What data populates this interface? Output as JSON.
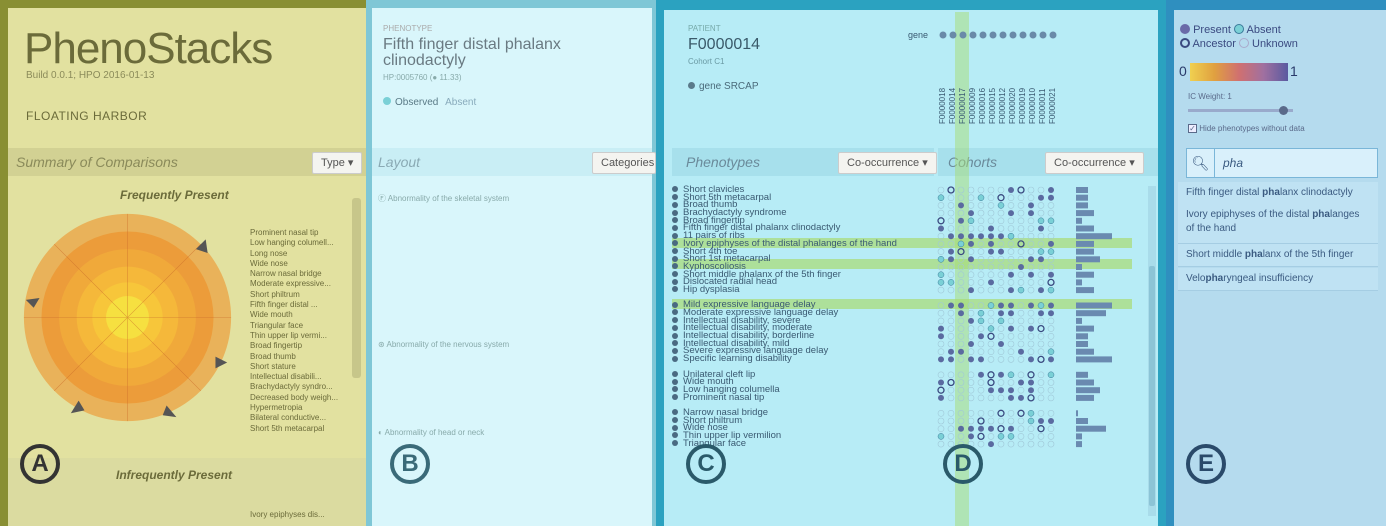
{
  "panelA": {
    "title": "PhenoStacks",
    "build": "Build 0.0.1; HPO 2016-01-13",
    "family": "FLOATING HARBOR",
    "header": "Summary of Comparisons",
    "type_button": "Type ▾",
    "freq_title": "Frequently Present",
    "infreq_title": "Infrequently Present",
    "legend": [
      "Prominent nasal tip",
      "Low hanging columell...",
      "Long nose",
      "Wide nose",
      "Narrow nasal bridge",
      "Moderate expressive...",
      "Short philtrum",
      "Fifth finger distal ...",
      "Wide mouth",
      "Triangular face",
      "Thin upper lip vermi...",
      "Broad fingertip",
      "Broad thumb",
      "Short stature",
      "Intellectual disabili...",
      "Brachydactyly syndro...",
      "Decreased body weigh...",
      "Hypermetropia",
      "Bilateral conductive...",
      "Short 5th metacarpal"
    ],
    "infreq_item": "Ivory epiphyses dis...",
    "label": "A"
  },
  "panelB": {
    "overline": "PHENOTYPE",
    "phenotype": "Fifth finger distal phalanx clinodactyly",
    "hpo": "HP:0005760",
    "hpo_ic": "(● 11.33)",
    "observed": "Observed",
    "absent": "Absent",
    "header": "Layout",
    "categories_button": "Categories ▾",
    "cats": [
      "Abnormality of the skeletal system",
      "Abnormality of the nervous system",
      "Abnormality of head or neck"
    ],
    "label": "B"
  },
  "panelC": {
    "overline": "PATIENT",
    "patient": "F0000014",
    "cohort": "Cohort C1",
    "gene_label": "gene",
    "gene": "SRCAP",
    "header": "Phenotypes",
    "cooc_button": "Co-occurrence ▾",
    "label": "C",
    "phenotypes": [
      "Short clavicles",
      "Short 5th metacarpal",
      "Broad thumb",
      "Brachydactyly syndrome",
      "Broad fingertip",
      "Fifth finger distal phalanx clinodactyly",
      "11 pairs of ribs",
      "Ivory epiphyses of the distal phalanges of the hand",
      "Short 4th toe",
      "Short 1st metacarpal",
      "Kyphoscoliosis",
      "Short middle phalanx of the 5th finger",
      "Dislocated radial head",
      "Hip dysplasia",
      "",
      "Mild expressive language delay",
      "Moderate expressive language delay",
      "Intellectual disability, severe",
      "Intellectual disability, moderate",
      "Intellectual disability, borderline",
      "Intellectual disability, mild",
      "Severe expressive language delay",
      "Specific learning disability",
      "",
      "Unilateral cleft lip",
      "Wide mouth",
      "Low hanging columella",
      "Prominent nasal tip",
      "",
      "Narrow nasal bridge",
      "Short philtrum",
      "Wide nose",
      "Thin upper lip vermilion",
      "Triangular face"
    ]
  },
  "panelD": {
    "gene_label": "gene",
    "header": "Cohorts",
    "cooc_button": "Co-occurrence ▾",
    "patients": [
      "F0000018",
      "F0000014",
      "F0000017",
      "F0000009",
      "F0000016",
      "F0000015",
      "F0000012",
      "F0000020",
      "F0000019",
      "F0000010",
      "F0000011",
      "F0000021"
    ],
    "label": "D"
  },
  "panelE": {
    "present": "Present",
    "absent": "Absent",
    "ancestor": "Ancestor",
    "unknown": "Unknown",
    "scale_min": "0",
    "scale_max": "1",
    "ic_weight": "IC Weight: 1",
    "ic_weight_value": 0.9,
    "hide_label": "Hide phenotypes without data",
    "search_value": "pha",
    "results": [
      [
        "Fifth finger distal ",
        "pha",
        "lanx clinodactyly"
      ],
      [
        "Ivory epiphyses of the distal ",
        "pha",
        "langes of the hand"
      ],
      [
        "Short middle ",
        "pha",
        "lanx of the 5th finger"
      ],
      [
        "Velo",
        "pha",
        "ryngeal insufficiency"
      ]
    ],
    "label": "E"
  }
}
